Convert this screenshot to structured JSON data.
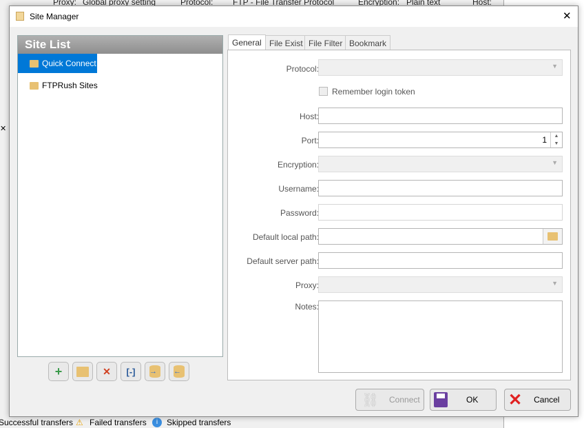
{
  "background_app": {
    "toolbar": {
      "proxy_label": "Proxy:",
      "proxy_value": "Global proxy setting",
      "protocol_label": "Protocol:",
      "protocol_value": "FTP - File Transfer Protocol",
      "encryption_label": "Encryption:",
      "encryption_value": "Plain text",
      "host_label": "Host:"
    },
    "status_tabs": [
      "Successful transfers",
      "Failed transfers",
      "Skipped transfers"
    ]
  },
  "dialog": {
    "title": "Site Manager",
    "close": "✕"
  },
  "site_list": {
    "title": "Site List",
    "items": [
      {
        "label": "Quick Connect",
        "selected": true
      },
      {
        "label": "FTPRush Sites",
        "selected": false
      }
    ]
  },
  "toolbar": {
    "add": "+",
    "delete": "✕"
  },
  "tabs": [
    "General",
    "File Exist",
    "File Filter",
    "Bookmark"
  ],
  "form": {
    "protocol_label": "Protocol:",
    "protocol_value": "",
    "remember_label": "Remember login token",
    "remember_checked": false,
    "host_label": "Host:",
    "host_value": "",
    "port_label": "Port:",
    "port_value": "1",
    "encryption_label": "Encryption:",
    "encryption_value": "",
    "username_label": "Username:",
    "username_value": "",
    "password_label": "Password:",
    "password_value": "",
    "local_path_label": "Default local path:",
    "local_path_value": "",
    "server_path_label": "Default server path:",
    "server_path_value": "",
    "proxy_label": "Proxy:",
    "proxy_value": "",
    "notes_label": "Notes:",
    "notes_value": ""
  },
  "buttons": {
    "connect": "Connect",
    "ok": "OK",
    "cancel": "Cancel"
  },
  "colors": {
    "selection": "#0078d7",
    "cancel_red": "#e02020",
    "ok_purple": "#6a3fa0"
  }
}
